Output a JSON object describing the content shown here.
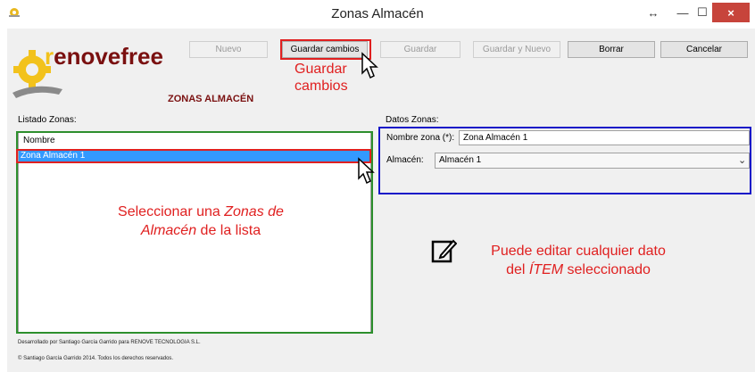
{
  "window": {
    "title": "Zonas Almacén",
    "resize_glyph": "↔",
    "minimize_glyph": "—",
    "maximize_glyph": "☐",
    "close_glyph": "×"
  },
  "logo": {
    "text_r": "r",
    "text_rest": "enovefree"
  },
  "section_title": "ZONAS ALMACÉN",
  "toolbar": {
    "nuevo": "Nuevo",
    "guardar_cambios": "Guardar cambios",
    "guardar": "Guardar",
    "guardar_y_nuevo": "Guardar y Nuevo",
    "borrar": "Borrar",
    "cancelar": "Cancelar"
  },
  "list": {
    "label": "Listado Zonas:",
    "header": "Nombre",
    "items": [
      "Zona Almacén 1"
    ]
  },
  "form": {
    "label": "Datos Zonas:",
    "nombre_label": "Nombre zona (*):",
    "nombre_value": "Zona Almacén 1",
    "almacen_label": "Almacén:",
    "almacen_value": "Almacén 1"
  },
  "annotations": {
    "guardar_line1": "Guardar",
    "guardar_line2": "cambios",
    "select_pre": "Seleccionar una ",
    "select_em1": "Zonas de",
    "select_em2": "Almacén",
    "select_post": " de la lista",
    "edit_line1": "Puede editar cualquier dato",
    "edit_pre": "del ",
    "edit_em": "ÍTEM",
    "edit_post": " seleccionado"
  },
  "footer": {
    "line1": "Desarrollado por Santiago García Garrido para RENOVE TECNOLOGIA S.L.",
    "line2": "© Santiago García Garrido 2014. Todos los derechos reservados."
  },
  "colors": {
    "brand": "#7a1010",
    "selection": "#3399ff",
    "annotation_red": "#e02020",
    "annotation_green": "#2d8f2d",
    "annotation_blue": "#1515c8"
  }
}
